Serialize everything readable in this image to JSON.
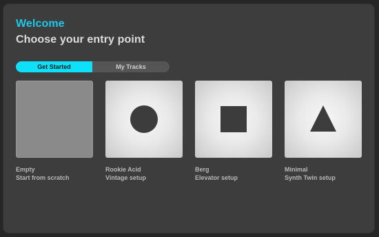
{
  "header": {
    "welcome": "Welcome",
    "subtitle": "Choose your entry point"
  },
  "tabs": [
    {
      "label": "Get Started",
      "active": true
    },
    {
      "label": "My Tracks",
      "active": false
    }
  ],
  "cards": [
    {
      "title": "Empty",
      "description": "Start from scratch",
      "icon": "empty"
    },
    {
      "title": "Rookie Acid",
      "description": "Vintage setup",
      "icon": "circle-icon"
    },
    {
      "title": "Berg",
      "description": "Elevator setup",
      "icon": "square-icon"
    },
    {
      "title": "Minimal",
      "description": "Synth Twin setup",
      "icon": "triangle-icon"
    }
  ],
  "colors": {
    "accent": "#0ee0fa",
    "welcome_text": "#1fc8e8",
    "window_background": "#3d3d3d",
    "tab_inactive_background": "#555555"
  }
}
